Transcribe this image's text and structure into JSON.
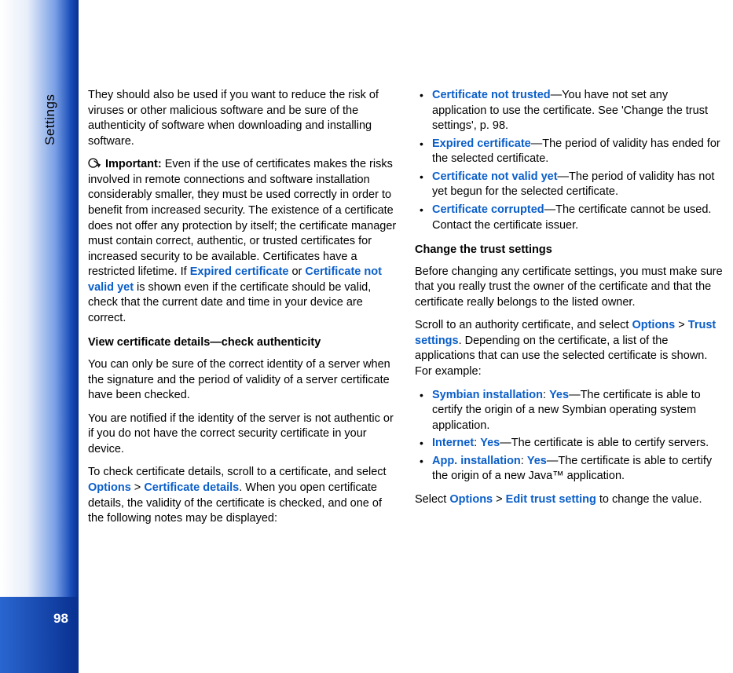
{
  "sidebar": {
    "label": "Settings",
    "page_number": "98"
  },
  "left": {
    "p1": "They should also be used if you want to reduce the risk of viruses or other malicious software and be sure of the authenticity of software when downloading and installing software.",
    "important_label": "Important:",
    "important_a": " Even if the use of certificates makes the risks involved in remote connections and software installation considerably smaller, they must be used correctly in order to benefit from increased security. The existence of a certificate does not offer any protection by itself; the certificate manager must contain correct, authentic, or trusted certificates for increased security to be available. Certificates have a restricted lifetime. If ",
    "expired": "Expired certificate",
    "important_or": " or ",
    "notvalid": "Certificate not valid yet",
    "important_b": " is shown even if the certificate should be valid, check that the current date and time in your device are correct.",
    "h_view": "View certificate details—check authenticity",
    "p2": "You can only be sure of the correct identity of a server when the signature and the period of validity of a server certificate have been checked.",
    "p3": "You are notified if the identity of the server is not authentic or if you do not have the correct security certificate in your device.",
    "p4a": "To check certificate details, scroll to a certificate, and select ",
    "options": "Options",
    "gt": " > ",
    "certdetails": "Certificate details",
    "p4b": ". When you open certificate details, the validity of the certificate is checked, and one of the following notes may be displayed:"
  },
  "right": {
    "bullets1": [
      {
        "term": "Certificate not trusted",
        "text": "—You have not set any application to use the certificate. See 'Change the trust settings', p. 98."
      },
      {
        "term": "Expired certificate",
        "text": "—The period of validity has ended for the selected certificate."
      },
      {
        "term": "Certificate not valid yet",
        "text": "—The period of validity has not yet begun for the selected certificate."
      },
      {
        "term": "Certificate corrupted",
        "text": "—The certificate cannot be used. Contact the certificate issuer."
      }
    ],
    "h_change": "Change the trust settings",
    "p5": "Before changing any certificate settings, you must make sure that you really trust the owner of the certificate and that the certificate really belongs to the listed owner.",
    "p6a": "Scroll to an authority certificate, and select ",
    "options": "Options",
    "gt": " > ",
    "trustsettings": "Trust settings",
    "p6b": ". Depending on the certificate, a list of the applications that can use the selected certificate is shown. For example:",
    "bullets2": [
      {
        "term": "Symbian installation",
        "sep": ": ",
        "val": "Yes",
        "text": "—The certificate is able to certify the origin of a new Symbian operating system application."
      },
      {
        "term": "Internet",
        "sep": ": ",
        "val": "Yes",
        "text": "—The certificate is able to certify servers."
      },
      {
        "term": "App. installation",
        "sep": ": ",
        "val": "Yes",
        "text": "—The certificate is able to certify the origin of a new Java™ application."
      }
    ],
    "p7a": "Select ",
    "p7b": " > ",
    "edittrust": "Edit trust setting",
    "p7c": " to change the value."
  }
}
